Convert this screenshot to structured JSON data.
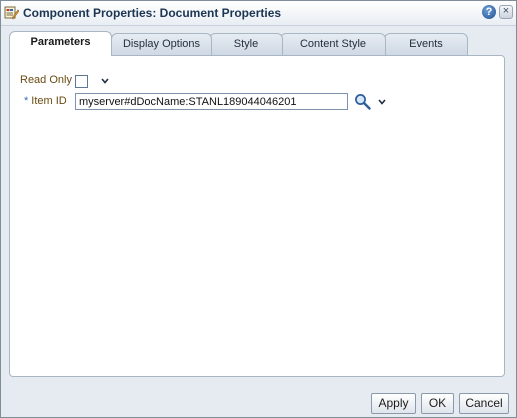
{
  "dialog": {
    "title": "Component Properties: Document Properties",
    "title_icon": "properties-icon",
    "help_icon": "help-icon",
    "help_label": "?",
    "close_icon": "close-icon",
    "close_label": "×"
  },
  "tabs": [
    {
      "label": "Parameters",
      "active": true
    },
    {
      "label": "Display Options",
      "active": false
    },
    {
      "label": "Style",
      "active": false
    },
    {
      "label": "Content Style",
      "active": false
    },
    {
      "label": "Events",
      "active": false
    }
  ],
  "fields": {
    "read_only": {
      "label": "Read Only",
      "checked": false
    },
    "item_id": {
      "required_marker": "*",
      "label": "Item ID",
      "value": "myserver#dDocName:STANL189044046201"
    }
  },
  "footer": {
    "apply_label": "Apply",
    "ok_label": "OK",
    "cancel_label": "Cancel"
  },
  "colors": {
    "accent": "#1c3553",
    "label_text": "#6a4b12",
    "required_marker": "#3a6bbf",
    "dialog_background": "#e6ebf1"
  }
}
